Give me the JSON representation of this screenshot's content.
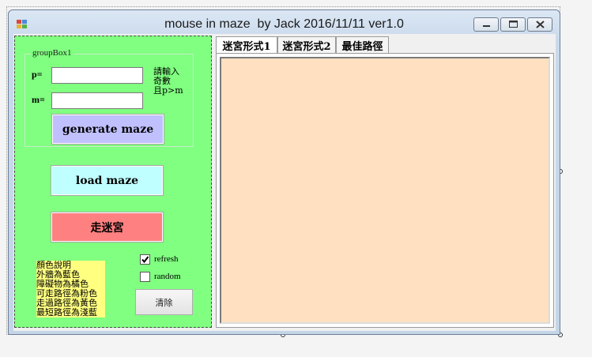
{
  "window": {
    "title": "mouse in maze  by Jack 2016/11/11 ver1.0",
    "icon": "app-icon",
    "caption_buttons": [
      "minimize-icon",
      "maximize-icon",
      "close-icon"
    ]
  },
  "groupbox": {
    "title": "groupBox1",
    "p_label": "p=",
    "m_label": "m=",
    "p_value": "",
    "m_value": "",
    "hint_lines": [
      "請輸入",
      "奇數",
      "且p>m"
    ]
  },
  "buttons": {
    "generate": "generate maze",
    "load": "load maze",
    "walk": "走迷宮",
    "clear": "清除"
  },
  "legend": {
    "lines": [
      "顏色說明",
      "外牆為藍色",
      "障礙物為橘色",
      "可走路徑為粉色",
      "走過路徑為黃色",
      "最短路徑為淺藍"
    ]
  },
  "checkboxes": {
    "refresh": {
      "label": "refresh",
      "checked": true
    },
    "random": {
      "label": "random",
      "checked": false
    }
  },
  "tabs": [
    "迷宮形式1",
    "迷宮形式2",
    "最佳路徑"
  ],
  "colors": {
    "panel": "#80ff80",
    "generate_button": "#c0c0ff",
    "load_button": "#c0ffff",
    "walk_button": "#ff8080",
    "legend_bg": "#ffff80",
    "maze_bg": "#ffe0c0"
  }
}
